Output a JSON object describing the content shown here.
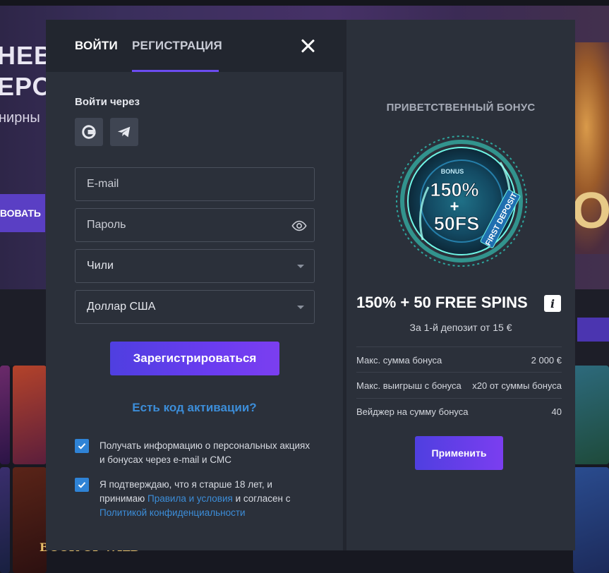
{
  "background": {
    "banner_line1": "НЕВН",
    "banner_line2": "ЕРОП",
    "banner_line3": "нирны",
    "banner_button": "ТВОВАТЬ",
    "hero_letter": "O",
    "game_label": "BOOK OF WILD"
  },
  "tabs": {
    "login": "ВОЙТИ",
    "register": "РЕГИСТРАЦИЯ"
  },
  "form": {
    "login_via": "Войти через",
    "email_placeholder": "E-mail",
    "password_placeholder": "Пароль",
    "country": "Чили",
    "currency": "Доллар США",
    "submit": "Зарегистрироваться",
    "activation_link": "Есть код активации?",
    "checkbox1": "Получать информацию о персональных акциях и бонусах через e-mail и СМС",
    "checkbox2_part1": "Я подтверждаю, что я старше 18 лет, и принимаю ",
    "checkbox2_link1": "Правила и условия",
    "checkbox2_part2": " и согласен с ",
    "checkbox2_link2": "Политикой конфиденциальности"
  },
  "bonus": {
    "title": "ПРИВЕТСТВЕННЫЙ БОНУС",
    "badge_bonus": "BONUS",
    "badge_percent": "150%",
    "badge_plus": "+",
    "badge_fs": "50FS",
    "badge_ribbon": "FIRST DEPOSIT",
    "offer": "150% + 50 FREE SPINS",
    "info": "i",
    "subtitle": "За 1-й депозит от 15 €",
    "rows": [
      {
        "label": "Макс. сумма бонуса",
        "value": "2 000 €"
      },
      {
        "label": "Макс. выигрыш с бонуса",
        "value": "x20 от суммы бонуса"
      },
      {
        "label": "Вейджер на сумму бонуса",
        "value": "40"
      }
    ],
    "apply": "Применить"
  },
  "colors": {
    "accent": "#6b4cf0",
    "link": "#3c8dd8",
    "panel": "#2b303a",
    "checkbox": "#2f83d6"
  }
}
